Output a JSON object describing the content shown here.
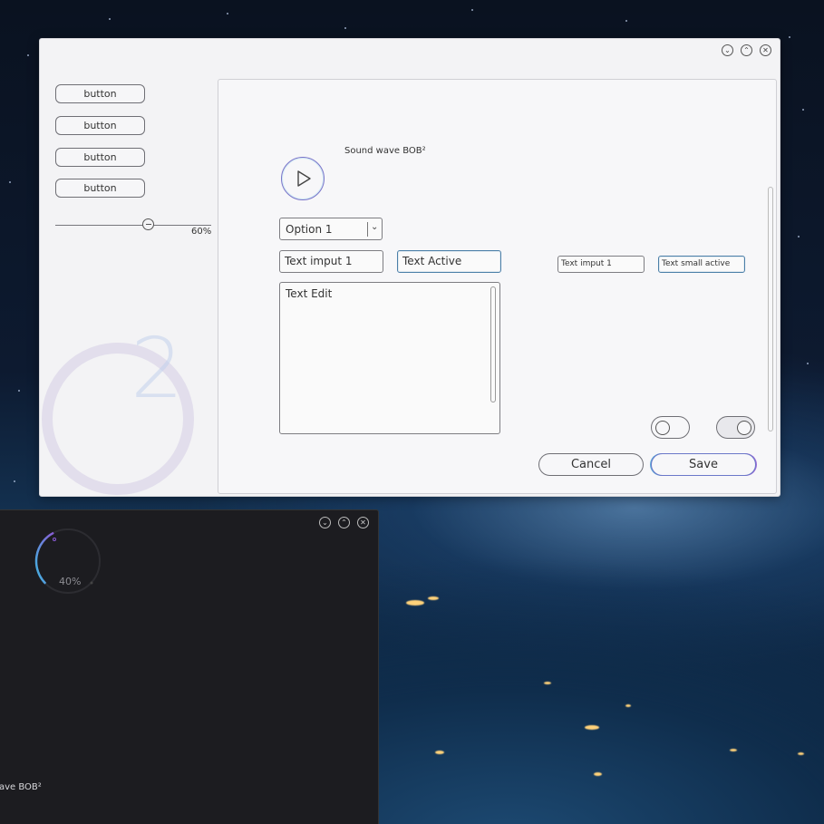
{
  "light_window": {
    "controls": {
      "minimize": "⌄",
      "maximize": "⌃",
      "close": "✕"
    },
    "side_buttons": [
      "button",
      "button",
      "button",
      "button"
    ],
    "slider": {
      "value_label": "60%",
      "value": 0.6
    },
    "panel": {
      "sound_wave_title": "Sound wave BOB²",
      "dropdown": {
        "selected": "Option 1"
      },
      "text_input_1": "Text imput 1",
      "text_input_active": "Text Active",
      "text_input_small": "Text imput 1",
      "text_input_small_active": "Text  small active",
      "text_edit": "Text Edit",
      "toggle_1": false,
      "toggle_2": true,
      "cancel_label": "Cancel",
      "save_label": "Save"
    }
  },
  "dark_window": {
    "controls": {
      "minimize": "⌄",
      "maximize": "⌃",
      "close": "✕"
    },
    "dial": {
      "value_label": "40%",
      "value": 0.4
    },
    "sound_wave_title": "ave BOB²"
  },
  "colors": {
    "accent_purple": "#8a5bd6",
    "accent_cyan": "#3fb6e0",
    "light_bg": "#f3f3f5",
    "dark_bg": "#1c1c20"
  }
}
